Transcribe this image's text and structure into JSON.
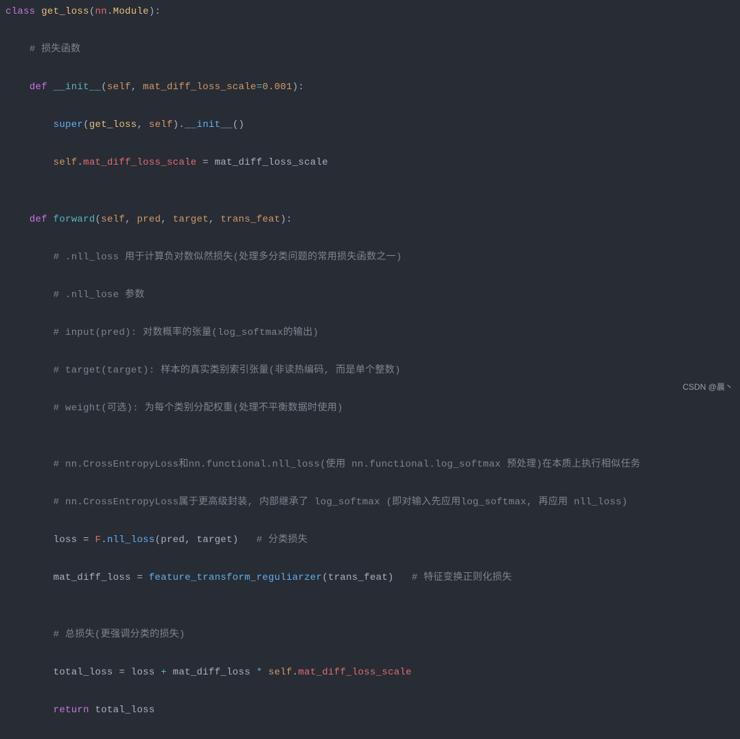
{
  "code": {
    "l1": {
      "kw1": "class",
      "cls": " get_loss",
      "p1": "(",
      "ns": "nn",
      "dot": ".",
      "mod": "Module",
      "p2": "):"
    },
    "l2": {
      "indent": "    ",
      "c": "# 损失函数"
    },
    "l3": {
      "indent": "    ",
      "kw": "def",
      "fn": " __init__",
      "p1": "(",
      "self": "self",
      "c1": ", ",
      "arg": "mat_diff_loss_scale",
      "eq": "=",
      "num": "0.001",
      "p2": "):"
    },
    "l4": {
      "indent": "        ",
      "fn": "super",
      "p1": "(",
      "cls": "get_loss",
      "c1": ", ",
      "self": "self",
      "p2": ").",
      "fn2": "__init__",
      "p3": "()"
    },
    "l5": {
      "indent": "        ",
      "self": "self",
      "dot": ".",
      "attr": "mat_diff_loss_scale",
      "eq": " = ",
      "var": "mat_diff_loss_scale"
    },
    "l6": {
      "indent": ""
    },
    "l7": {
      "indent": "    ",
      "kw": "def",
      "fn": " forward",
      "p1": "(",
      "self": "self",
      "c": ", ",
      "a1": "pred",
      "a2": "target",
      "a3": "trans_feat",
      "p2": "):"
    },
    "l8": {
      "indent": "        ",
      "c": "# .nll_loss 用于计算负对数似然损失(处理多分类问题的常用损失函数之一)"
    },
    "l9": {
      "indent": "        ",
      "c": "# .nll_lose 参数"
    },
    "l10": {
      "indent": "        ",
      "c": "# input(pred): 对数概率的张量(log_softmax的输出)"
    },
    "l11": {
      "indent": "        ",
      "c": "# target(target): 样本的真实类别索引张量(非读热编码, 而是单个整数)"
    },
    "l12": {
      "indent": "        ",
      "c": "# weight(可选): 为每个类别分配权重(处理不平衡数据时使用)"
    },
    "l13": {
      "indent": ""
    },
    "l14": {
      "indent": "        ",
      "c": "# nn.CrossEntropyLoss和nn.functional.nll_loss(使用 nn.functional.log_softmax 预处理)在本质上执行相似任务"
    },
    "l15": {
      "indent": "        ",
      "c": "# nn.CrossEntropyLoss属于更高级封装, 内部继承了 log_softmax (即对输入先应用log_softmax, 再应用 nll_loss)"
    },
    "l16": {
      "indent": "        ",
      "v": "loss",
      "eq": " = ",
      "ns": "F",
      "dot": ".",
      "fn": "nll_loss",
      "p1": "(",
      "a1": "pred",
      "c1": ", ",
      "a2": "target",
      "p2": ")",
      "sp": "   ",
      "cm": "# 分类损失"
    },
    "l17": {
      "indent": "        ",
      "v": "mat_diff_loss",
      "eq": " = ",
      "fn": "feature_transform_reguliarzer",
      "p1": "(",
      "a1": "trans_feat",
      "p2": ")",
      "sp": "   ",
      "cm": "# 特征变换正则化损失"
    },
    "l18": {
      "indent": ""
    },
    "l19": {
      "indent": "        ",
      "c": "# 总损失(更强调分类的损失)"
    },
    "l20": {
      "indent": "        ",
      "v": "total_loss",
      "eq": " = ",
      "a1": "loss",
      "op": " + ",
      "a2": "mat_diff_loss",
      "op2": " * ",
      "self": "self",
      "dot": ".",
      "attr": "mat_diff_loss_scale"
    },
    "l21": {
      "indent": "        ",
      "kw": "return",
      "sp": " ",
      "v": "total_loss"
    }
  },
  "watermark": "CSDN @晨丶"
}
